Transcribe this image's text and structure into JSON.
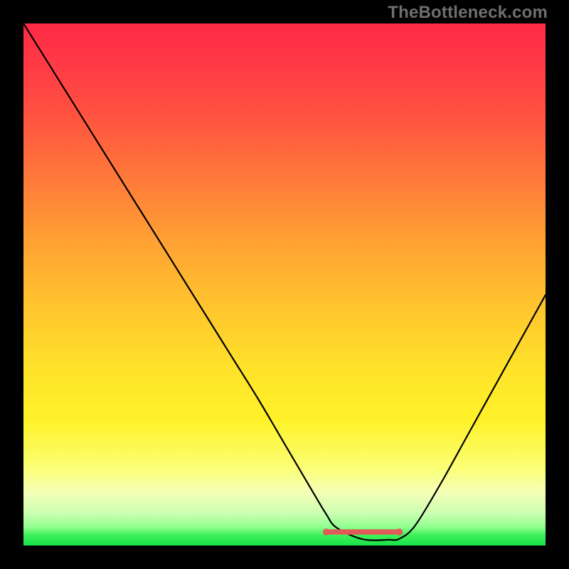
{
  "watermark": "TheBottleneck.com",
  "chart_data": {
    "type": "line",
    "title": "",
    "xlabel": "",
    "ylabel": "",
    "xlim": [
      0,
      100
    ],
    "ylim": [
      0,
      100
    ],
    "series": [
      {
        "name": "bottleneck-curve",
        "x": [
          0,
          5,
          10,
          15,
          20,
          25,
          30,
          35,
          40,
          45,
          50,
          55,
          58,
          60,
          65,
          70,
          72,
          75,
          80,
          85,
          90,
          95,
          100
        ],
        "values": [
          100,
          92,
          84,
          76,
          68,
          60,
          52,
          44,
          36,
          28,
          19.5,
          11,
          6,
          3.4,
          1.2,
          1.1,
          1.3,
          3.8,
          12,
          21,
          30,
          39,
          48
        ]
      }
    ],
    "flat_region": {
      "x_start": 58,
      "x_end": 72,
      "y": 2.6
    },
    "colors": {
      "curve": "#000000",
      "flat_segment": "#e35a5a",
      "gradient_top": "#ff2b47",
      "gradient_mid": "#ffe22a",
      "gradient_bottom": "#19e24a",
      "frame": "#000000",
      "watermark": "#6f6f6f"
    }
  }
}
